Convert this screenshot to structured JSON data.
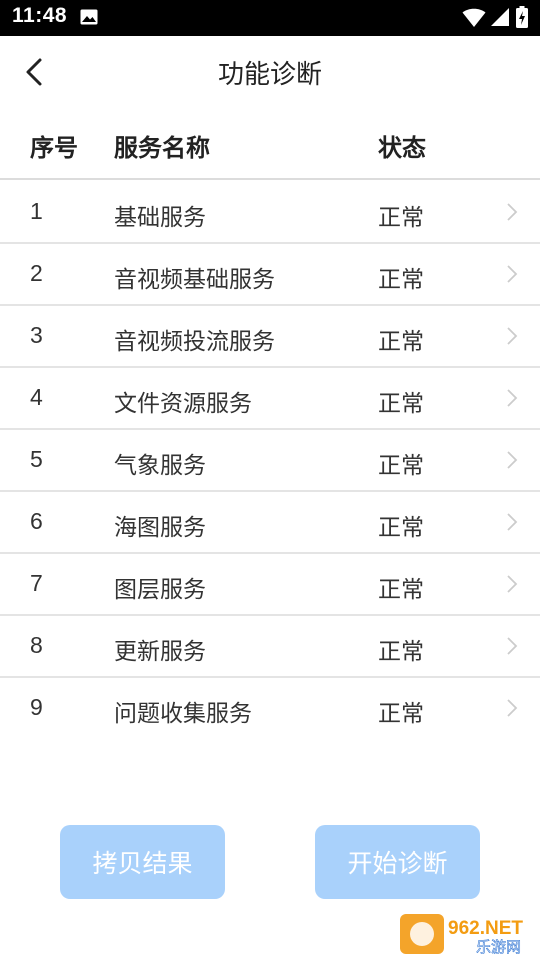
{
  "status_bar": {
    "time": "11:48"
  },
  "header": {
    "title": "功能诊断"
  },
  "table": {
    "columns": [
      "序号",
      "服务名称",
      "状态"
    ],
    "rows": [
      {
        "index": "1",
        "name": "基础服务",
        "status": "正常"
      },
      {
        "index": "2",
        "name": "音视频基础服务",
        "status": "正常"
      },
      {
        "index": "3",
        "name": "音视频投流服务",
        "status": "正常"
      },
      {
        "index": "4",
        "name": "文件资源服务",
        "status": "正常"
      },
      {
        "index": "5",
        "name": "气象服务",
        "status": "正常"
      },
      {
        "index": "6",
        "name": "海图服务",
        "status": "正常"
      },
      {
        "index": "7",
        "name": "图层服务",
        "status": "正常"
      },
      {
        "index": "8",
        "name": "更新服务",
        "status": "正常"
      },
      {
        "index": "9",
        "name": "问题收集服务",
        "status": "正常"
      }
    ]
  },
  "buttons": {
    "copy_label": "拷贝结果",
    "start_label": "开始诊断"
  },
  "watermark": {
    "text_top": "962.NET",
    "text_bottom": "乐游网"
  },
  "colors": {
    "button_bg": "#a9d1fb",
    "divider": "#e4e4e4",
    "chevron": "#cccccc"
  },
  "icons": {
    "back": "chevron-left-icon",
    "row_arrow": "chevron-right-icon"
  }
}
